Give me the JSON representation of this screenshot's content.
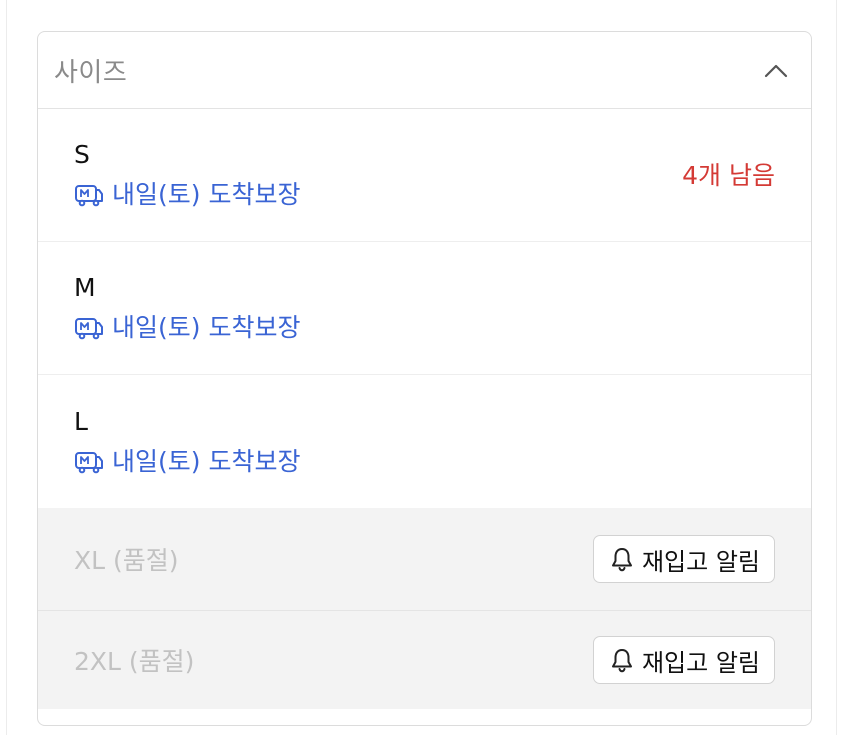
{
  "select": {
    "placeholder": "사이즈",
    "icon": "chevron-up-icon"
  },
  "options": [
    {
      "name": "S",
      "delivery": "내일(토) 도착보장",
      "stock_note": "4개 남음",
      "delivery_icon": "truck-icon"
    },
    {
      "name": "M",
      "delivery": "내일(토) 도착보장",
      "delivery_icon": "truck-icon"
    },
    {
      "name": "L",
      "delivery": "내일(토) 도착보장",
      "delivery_icon": "truck-icon"
    }
  ],
  "soldout_options": [
    {
      "name": "XL (품절)",
      "restock_label": "재입고 알림",
      "icon": "bell-icon"
    },
    {
      "name": "2XL (품절)",
      "restock_label": "재입고 알림",
      "icon": "bell-icon"
    }
  ],
  "colors": {
    "delivery": "#3a64d4",
    "stock_warning": "#d43a35",
    "soldout_text": "#c2c2c2",
    "soldout_bg": "#f3f3f3"
  }
}
